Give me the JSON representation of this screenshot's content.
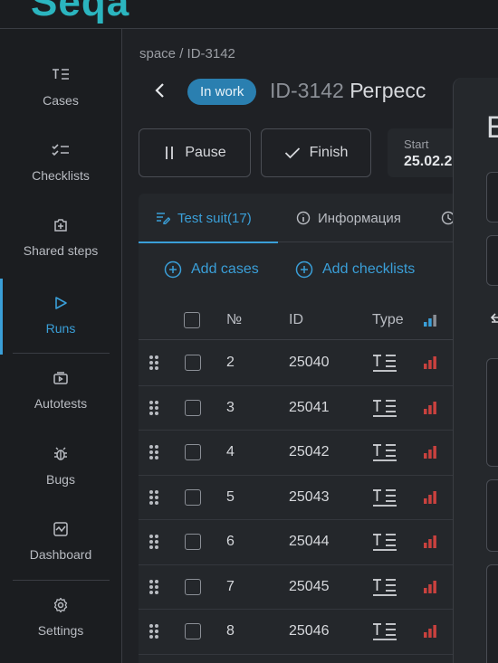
{
  "app": {
    "logo_text": "Seqa"
  },
  "sidebar": {
    "items": [
      {
        "label": "Cases",
        "icon": "cases-icon"
      },
      {
        "label": "Checklists",
        "icon": "checklists-icon"
      },
      {
        "label": "Shared steps",
        "icon": "shared-steps-icon"
      },
      {
        "label": "Runs",
        "icon": "runs-icon",
        "active": true
      },
      {
        "label": "Autotests",
        "icon": "autotests-icon"
      },
      {
        "label": "Bugs",
        "icon": "bug-icon"
      },
      {
        "label": "Dashboard",
        "icon": "dashboard-icon"
      },
      {
        "label": "Settings",
        "icon": "settings-icon"
      }
    ]
  },
  "header": {
    "breadcrumb": "space / ID-3142",
    "status": "In work",
    "run_id": "ID-3142",
    "run_name": "Регресс",
    "status_color": "#2a7fb0"
  },
  "actions": {
    "pause_label": "Pause",
    "finish_label": "Finish",
    "start_label": "Start",
    "start_value": "25.02.2"
  },
  "tabs": [
    {
      "label": "Test suit(17)",
      "active": true
    },
    {
      "label": "Информация",
      "active": false
    }
  ],
  "links": {
    "add_cases": "Add cases",
    "add_checklists": "Add checklists"
  },
  "table": {
    "columns": {
      "num": "№",
      "id": "ID",
      "type": "Type"
    },
    "rows": [
      {
        "num": "2",
        "id": "25040"
      },
      {
        "num": "3",
        "id": "25041"
      },
      {
        "num": "4",
        "id": "25042"
      },
      {
        "num": "5",
        "id": "25043"
      },
      {
        "num": "6",
        "id": "25044"
      },
      {
        "num": "7",
        "id": "25045"
      },
      {
        "num": "8",
        "id": "25046"
      }
    ]
  },
  "overlay": {
    "heading_initial": "E"
  },
  "colors": {
    "accent": "#3a9fd8",
    "priority_high": "#c9413e",
    "logo": "#2bb5bf"
  }
}
